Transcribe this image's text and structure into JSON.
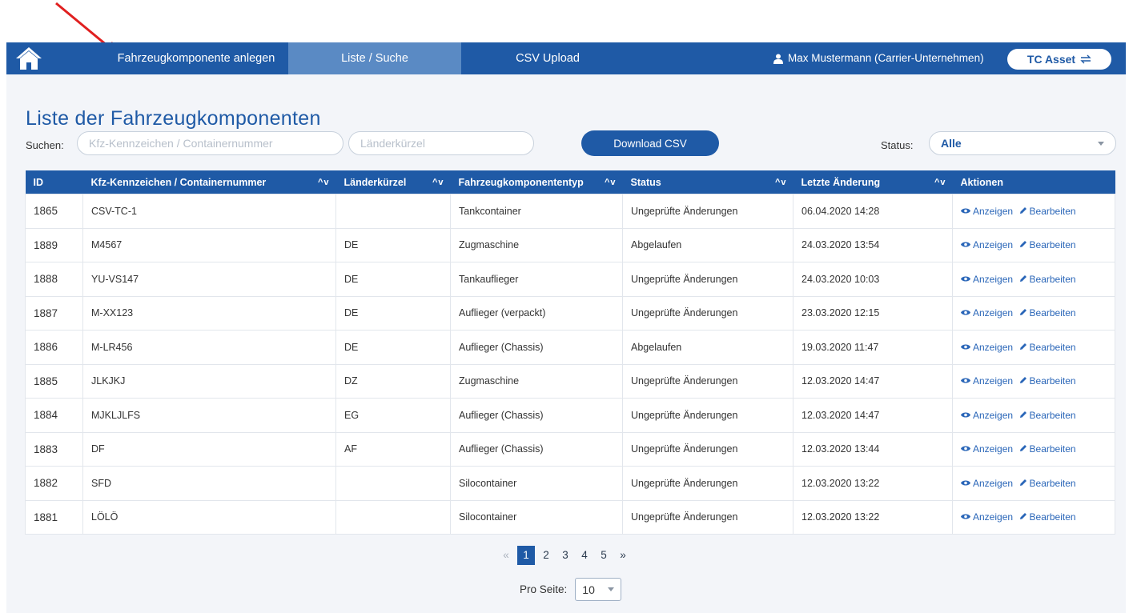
{
  "nav": {
    "items": [
      {
        "label": "Fahrzeugkomponente anlegen",
        "active": false
      },
      {
        "label": "Liste / Suche",
        "active": true
      },
      {
        "label": "CSV Upload",
        "active": false
      }
    ],
    "user": "Max Mustermann (Carrier-Unternehmen)",
    "tc_button": "TC Asset"
  },
  "page": {
    "title": "Liste der Fahrzeugkomponenten"
  },
  "filters": {
    "search_label": "Suchen:",
    "plate_placeholder": "Kfz-Kennzeichen / Containernummer",
    "country_placeholder": "Länderkürzel",
    "download_label": "Download CSV",
    "status_label": "Status:",
    "status_value": "Alle"
  },
  "table": {
    "columns": [
      "ID",
      "Kfz-Kennzeichen / Containernummer",
      "Länderkürzel",
      "Fahrzeugkomponententyp",
      "Status",
      "Letzte Änderung",
      "Aktionen"
    ],
    "sort_glyph": "^v",
    "rows": [
      {
        "id": "1865",
        "plate": "CSV-TC-1",
        "country": "",
        "type": "Tankcontainer",
        "status": "Ungeprüfte Änderungen",
        "changed": "06.04.2020 14:28"
      },
      {
        "id": "1889",
        "plate": "M4567",
        "country": "DE",
        "type": "Zugmaschine",
        "status": "Abgelaufen",
        "changed": "24.03.2020 13:54"
      },
      {
        "id": "1888",
        "plate": "YU-VS147",
        "country": "DE",
        "type": "Tankauflieger",
        "status": "Ungeprüfte Änderungen",
        "changed": "24.03.2020 10:03"
      },
      {
        "id": "1887",
        "plate": "M-XX123",
        "country": "DE",
        "type": "Auflieger (verpackt)",
        "status": "Ungeprüfte Änderungen",
        "changed": "23.03.2020 12:15"
      },
      {
        "id": "1886",
        "plate": "M-LR456",
        "country": "DE",
        "type": "Auflieger (Chassis)",
        "status": "Abgelaufen",
        "changed": "19.03.2020 11:47"
      },
      {
        "id": "1885",
        "plate": "JLKJKJ",
        "country": "DZ",
        "type": "Zugmaschine",
        "status": "Ungeprüfte Änderungen",
        "changed": "12.03.2020 14:47"
      },
      {
        "id": "1884",
        "plate": "MJKLJLFS",
        "country": "EG",
        "type": "Auflieger (Chassis)",
        "status": "Ungeprüfte Änderungen",
        "changed": "12.03.2020 14:47"
      },
      {
        "id": "1883",
        "plate": "DF",
        "country": "AF",
        "type": "Auflieger (Chassis)",
        "status": "Ungeprüfte Änderungen",
        "changed": "12.03.2020 13:44"
      },
      {
        "id": "1882",
        "plate": "SFD",
        "country": "",
        "type": "Silocontainer",
        "status": "Ungeprüfte Änderungen",
        "changed": "12.03.2020 13:22"
      },
      {
        "id": "1881",
        "plate": "LÖLÖ",
        "country": "",
        "type": "Silocontainer",
        "status": "Ungeprüfte Änderungen",
        "changed": "12.03.2020 13:22"
      }
    ],
    "action_view": "Anzeigen",
    "action_edit": "Bearbeiten"
  },
  "pagination": {
    "prev": "«",
    "pages": [
      "1",
      "2",
      "3",
      "4",
      "5"
    ],
    "current": "1",
    "next": "»",
    "per_page_label": "Pro Seite:",
    "per_page_value": "10"
  },
  "colors": {
    "primary": "#1f5aa6",
    "nav_active": "#5a8ac4",
    "arrow": "#e02020"
  }
}
